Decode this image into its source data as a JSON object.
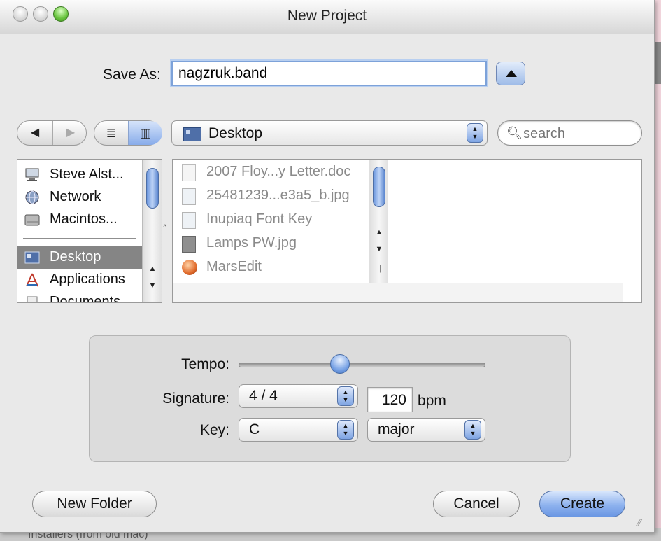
{
  "window": {
    "title": "New Project"
  },
  "save_as": {
    "label": "Save As:",
    "value": "nagzruk.band"
  },
  "toolbar": {
    "back_icon": "◀",
    "forward_icon": "▶",
    "list_view_icon": "≣",
    "column_view_icon": "▥",
    "location": "Desktop",
    "search_placeholder": "search"
  },
  "sidebar": {
    "items": [
      {
        "label": "Steve Alst...",
        "icon": "computer-icon",
        "selected": false
      },
      {
        "label": "Network",
        "icon": "network-icon",
        "selected": false
      },
      {
        "label": "Macintos...",
        "icon": "hard-drive-icon",
        "selected": false
      },
      {
        "label": "Desktop",
        "icon": "desktop-icon",
        "selected": true
      },
      {
        "label": "Applications",
        "icon": "applications-icon",
        "selected": false
      },
      {
        "label": "Documents",
        "icon": "documents-icon",
        "selected": false
      }
    ]
  },
  "files": {
    "items": [
      {
        "label": "2007 Floy...y Letter.doc",
        "icon": "document-icon"
      },
      {
        "label": "25481239...e3a5_b.jpg",
        "icon": "image-icon"
      },
      {
        "label": "Inupiaq Font Key",
        "icon": "image-icon"
      },
      {
        "label": "Lamps PW.jpg",
        "icon": "image-icon"
      },
      {
        "label": "MarsEdit",
        "icon": "app-icon"
      }
    ]
  },
  "options": {
    "tempo_label": "Tempo:",
    "tempo_level": 0.43,
    "signature_label": "Signature:",
    "signature_value": "4 / 4",
    "tempo_value": "120",
    "tempo_unit": "bpm",
    "key_label": "Key:",
    "key_value": "C",
    "mode_value": "major"
  },
  "buttons": {
    "new_folder": "New Folder",
    "cancel": "Cancel",
    "create": "Create"
  },
  "background": {
    "ghost_text": "Installers (from old mac)"
  },
  "colors": {
    "selection_gray": "#858585",
    "aqua_blue": "#7ea4e3",
    "focus_ring": "#7da2d9"
  }
}
